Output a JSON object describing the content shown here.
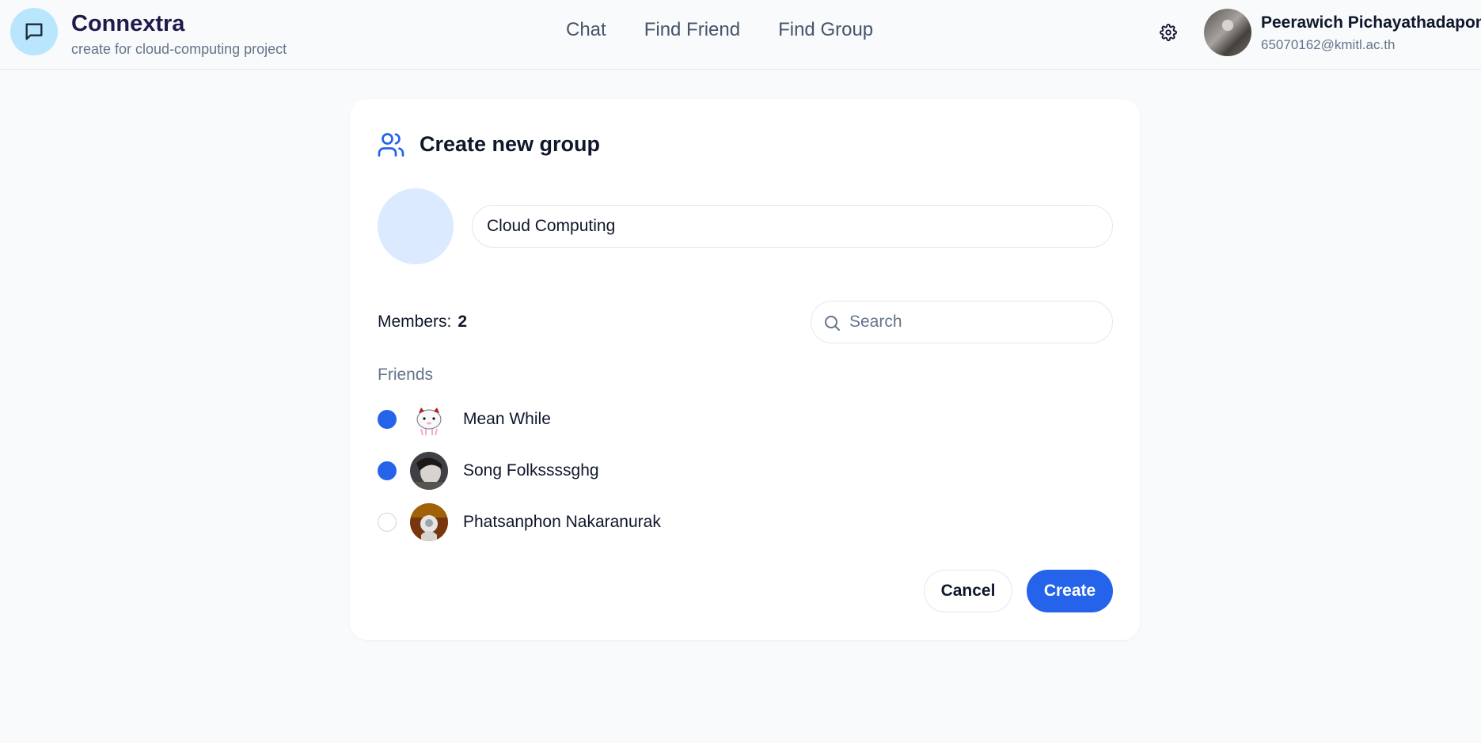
{
  "app": {
    "name": "Connextra",
    "tagline": "create for cloud-computing project"
  },
  "nav": {
    "items": [
      "Chat",
      "Find Friend",
      "Find Group"
    ]
  },
  "user": {
    "name": "Peerawich Pichayathadapong",
    "email": "65070162@kmitl.ac.th"
  },
  "dialog": {
    "title": "Create new group",
    "group_name_value": "Cloud Computing",
    "members_label": "Members:",
    "members_count": "2",
    "search_placeholder": "Search",
    "friends_label": "Friends",
    "friends": [
      {
        "name": "Mean While",
        "selected": true
      },
      {
        "name": "Song Folkssssghg",
        "selected": true
      },
      {
        "name": "Phatsanphon Nakaranurak",
        "selected": false
      }
    ],
    "cancel_label": "Cancel",
    "create_label": "Create"
  },
  "colors": {
    "accent": "#2563eb",
    "logo_bg": "#bae6fd",
    "group_avatar_bg": "#dbeafe"
  }
}
